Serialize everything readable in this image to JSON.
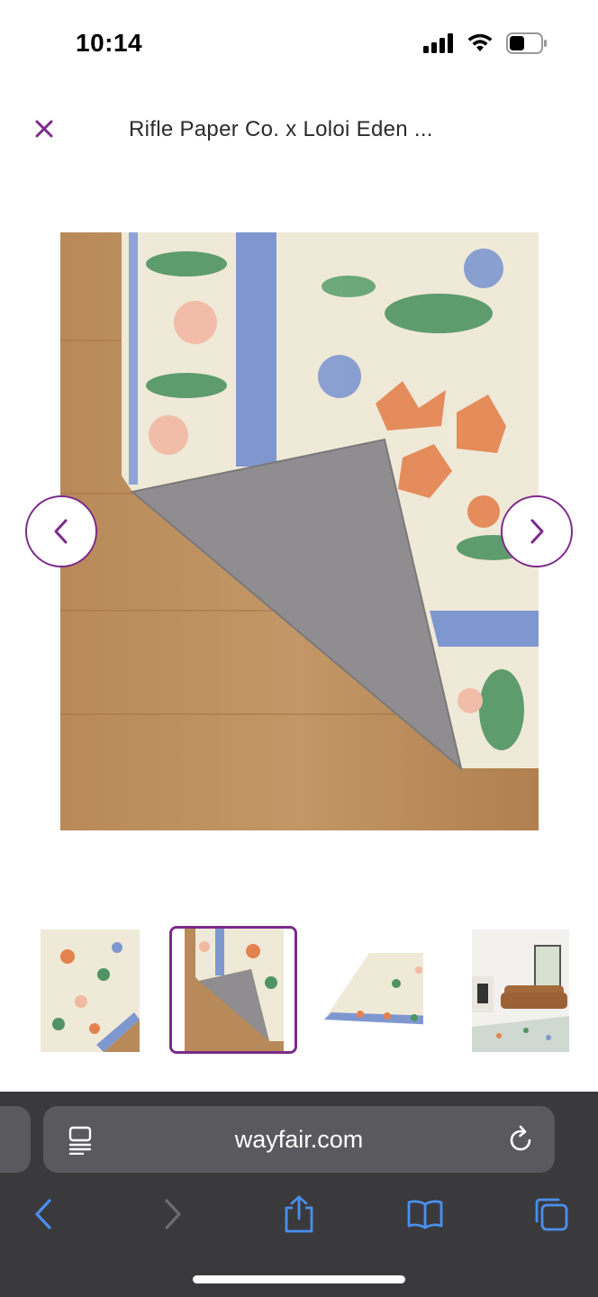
{
  "status": {
    "time": "10:14"
  },
  "header": {
    "title": "Rifle Paper Co. x Loloi Eden ..."
  },
  "browser": {
    "url": "wayfair.com"
  },
  "colors": {
    "accent": "#7b2a8a",
    "safari_bg": "#3a3a3c",
    "url_bar_bg": "#5a5a5e",
    "toolbar_icon": "#4a8ff0"
  },
  "icons": {
    "close": "close-icon",
    "prev": "chevron-left-icon",
    "next": "chevron-right-icon",
    "reader": "reader-mode-icon",
    "reload": "reload-icon",
    "back": "back-arrow-icon",
    "forward": "forward-arrow-icon",
    "share": "share-icon",
    "bookmarks": "bookmarks-icon",
    "tabs": "tabs-icon"
  },
  "gallery": {
    "thumbnail_count": 4,
    "selected_index": 1
  }
}
